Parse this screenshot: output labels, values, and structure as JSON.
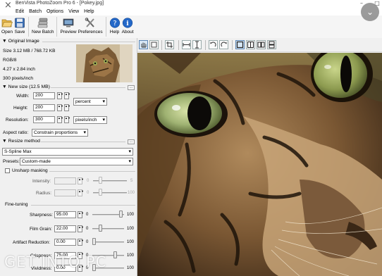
{
  "window": {
    "title": "BenVista PhotoZoom Pro 6 - [Pokey.jpg]",
    "close_glyph": "×",
    "minimize_glyph": "–",
    "maximize_glyph": "□"
  },
  "menu": [
    "Edit",
    "Batch",
    "Options",
    "View",
    "Help"
  ],
  "toolbar": {
    "open": "Open",
    "save": "Save",
    "new_batch": "New Batch",
    "preview": "Preview",
    "preferences": "Preferences",
    "help": "Help",
    "about": "About"
  },
  "original_image": {
    "header": "Original Image",
    "size": "Size 3.12 MB / 768.72 KB",
    "mode": "RGB/8",
    "dimensions": "4.27 x 2.84 inch",
    "resolution": "300 pixels/inch"
  },
  "new_size": {
    "header": "New size (12.5 MB)",
    "width_label": "Width:",
    "width_value": "200",
    "height_label": "Height:",
    "height_value": "200",
    "resolution_label": "Resolution:",
    "resolution_value": "300",
    "size_unit": "percent",
    "resolution_unit": "pixels/inch",
    "aspect_label": "Aspect ratio:",
    "aspect_value": "Constrain proportions",
    "more_button": "..."
  },
  "resize_method": {
    "header": "Resize method",
    "method": "S-Spline Max",
    "presets_label": "Presets:",
    "presets_value": "Custom-made",
    "more_button": "..."
  },
  "unsharp_masking": {
    "label": "Unsharp masking",
    "intensity_label": "Intensity:",
    "intensity_min": "0",
    "intensity_max": "5",
    "radius_label": "Radius:",
    "radius_min": "0",
    "radius_max": "100"
  },
  "fine_tuning": {
    "header": "Fine-tuning",
    "sharpness_label": "Sharpness:",
    "sharpness_value": "95.00",
    "film_grain_label": "Film Grain:",
    "film_grain_value": "22.00",
    "artifact_label": "Artifact Reduction:",
    "artifact_value": "0.00",
    "crispness_label": "Crispness:",
    "crispness_value": "75.00",
    "vividness_label": "Vividness:",
    "vividness_value": "0.00",
    "min": "0",
    "max": "100",
    "sharpness_level": 0.95,
    "film_grain_level": 0.22,
    "artifact_level": 0.0,
    "crispness_level": 0.75,
    "vividness_level": 0.0
  },
  "watermark": "GET INTO PC",
  "icons": {
    "open": "folder-open-icon",
    "save": "floppy-disk-icon",
    "new_batch": "batch-stack-icon",
    "preview": "monitor-preview-icon",
    "preferences": "tools-wrench-icon",
    "help": "help-circle-icon",
    "about": "info-circle-icon"
  },
  "colors": {
    "panel_bg": "#f0f0f0",
    "help_icon_blue": "#2468c8",
    "selection_blue": "#d7e7f5"
  }
}
